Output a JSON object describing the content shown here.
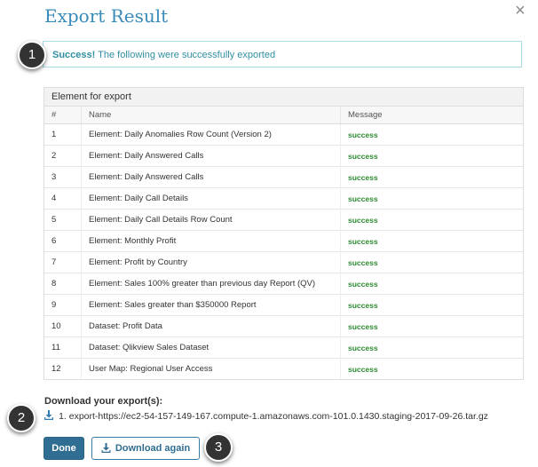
{
  "dialog": {
    "title": "Export Result",
    "close_glyph": "×"
  },
  "alert": {
    "strong": "Success!",
    "text": " The following were successfully exported"
  },
  "callouts": [
    "1",
    "2",
    "3"
  ],
  "table": {
    "panel_title": "Element for export",
    "headers": [
      "#",
      "Name",
      "Message"
    ],
    "rows": [
      {
        "num": "1",
        "name": "Element: Daily Anomalies Row Count (Version 2)",
        "message": "success"
      },
      {
        "num": "2",
        "name": "Element: Daily Answered Calls",
        "message": "success"
      },
      {
        "num": "3",
        "name": "Element: Daily Answered Calls",
        "message": "success"
      },
      {
        "num": "4",
        "name": "Element: Daily Call Details",
        "message": "success"
      },
      {
        "num": "5",
        "name": "Element: Daily Call Details Row Count",
        "message": "success"
      },
      {
        "num": "6",
        "name": "Element: Monthly Profit",
        "message": "success"
      },
      {
        "num": "7",
        "name": "Element: Profit by Country",
        "message": "success"
      },
      {
        "num": "8",
        "name": "Element: Sales 100% greater than previous day Report (QV)",
        "message": "success"
      },
      {
        "num": "9",
        "name": "Element: Sales greater than $350000 Report",
        "message": "success"
      },
      {
        "num": "10",
        "name": "Dataset: Profit Data",
        "message": "success"
      },
      {
        "num": "11",
        "name": "Dataset: Qlikview Sales Dataset",
        "message": "success"
      },
      {
        "num": "12",
        "name": "User Map: Regional User Access",
        "message": "success"
      }
    ]
  },
  "download": {
    "label": "Download your export(s):",
    "link_text": "1. export-https://ec2-54-157-149-167.compute-1.amazonaws.com-101.0.1430.staging-2017-09-26.tar.gz",
    "icon": "download-icon"
  },
  "buttons": {
    "done": "Done",
    "download_again": "Download again"
  },
  "colors": {
    "accent": "#3a8bb8",
    "success": "#2e8b2e",
    "primary_button": "#2f6d93"
  }
}
